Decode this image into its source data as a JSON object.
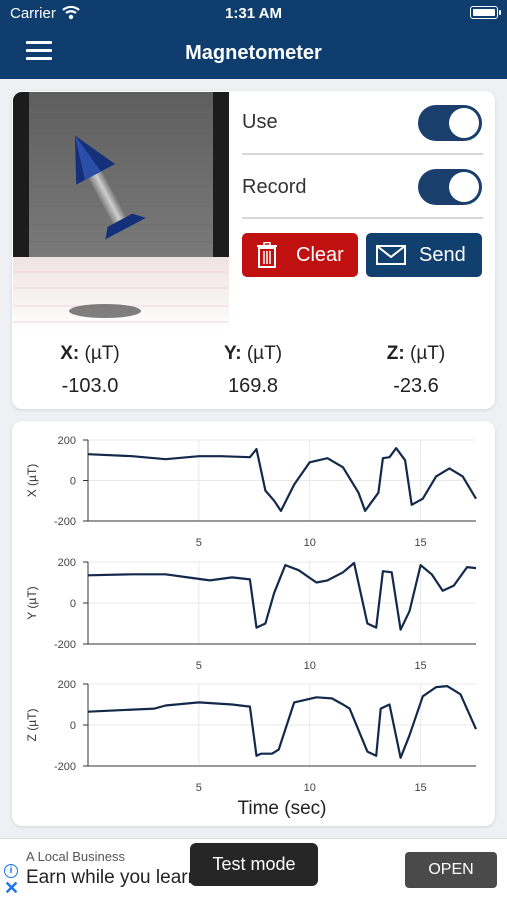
{
  "status_bar": {
    "carrier": "Carrier",
    "time": "1:31 AM"
  },
  "nav": {
    "title": "Magnetometer"
  },
  "controls": {
    "use_label": "Use",
    "use_on": true,
    "record_label": "Record",
    "record_on": true,
    "clear_label": "Clear",
    "send_label": "Send"
  },
  "readings": {
    "x_label": "X:",
    "x_unit": "(µT)",
    "x_value": "-103.0",
    "y_label": "Y:",
    "y_unit": "(µT)",
    "y_value": "169.8",
    "z_label": "Z:",
    "z_unit": "(µT)",
    "z_value": "-23.6"
  },
  "colors": {
    "bar": "#0e3d6e",
    "clear": "#c11010",
    "send": "#11406f",
    "line": "#13294b"
  },
  "chart_data": [
    {
      "type": "line",
      "ylabel": "X (µT)",
      "ylim": [
        -200,
        200
      ],
      "yticks": [
        200,
        0,
        -200
      ],
      "xlim": [
        0,
        17.5
      ],
      "xticks": [
        5,
        10,
        15
      ],
      "grid": true,
      "x": [
        0,
        2,
        3.5,
        5,
        6,
        7.3,
        7.6,
        8,
        8.4,
        8.7,
        9.3,
        10,
        10.8,
        11.5,
        12.2,
        12.5,
        13.1,
        13.3,
        13.6,
        13.9,
        14.3,
        14.6,
        15.1,
        15.7,
        16.3,
        16.9,
        17.5
      ],
      "y": [
        130,
        120,
        105,
        120,
        120,
        115,
        155,
        -50,
        -100,
        -150,
        -20,
        90,
        110,
        65,
        -60,
        -150,
        -60,
        110,
        115,
        160,
        100,
        -120,
        -90,
        20,
        60,
        20,
        -90
      ]
    },
    {
      "type": "line",
      "ylabel": "Y (µT)",
      "ylim": [
        -200,
        200
      ],
      "yticks": [
        200,
        0,
        -200
      ],
      "xlim": [
        0,
        17.5
      ],
      "xticks": [
        5,
        10,
        15
      ],
      "grid": true,
      "x": [
        0,
        2,
        3.5,
        4.5,
        5.5,
        6.5,
        7.3,
        7.6,
        8,
        8.4,
        8.9,
        9.5,
        10.3,
        10.8,
        11.5,
        12,
        12.6,
        13,
        13.3,
        13.7,
        14.1,
        14.5,
        15,
        15.5,
        16,
        16.5,
        17.1,
        17.5
      ],
      "y": [
        135,
        140,
        140,
        125,
        110,
        125,
        115,
        -120,
        -100,
        50,
        185,
        160,
        100,
        110,
        150,
        195,
        -100,
        -120,
        155,
        150,
        -130,
        -40,
        185,
        140,
        60,
        85,
        175,
        170
      ]
    },
    {
      "type": "line",
      "ylabel": "Z (µT)",
      "ylim": [
        -200,
        200
      ],
      "yticks": [
        200,
        0,
        -200
      ],
      "xlim": [
        0,
        17.5
      ],
      "xticks": [
        5,
        10,
        15
      ],
      "grid": true,
      "xlabel": "Time (sec)",
      "x": [
        0,
        2,
        3,
        3.5,
        5,
        6.5,
        7.3,
        7.6,
        7.8,
        8.3,
        8.6,
        9.3,
        10.3,
        11,
        11.5,
        11.8,
        12.6,
        13,
        13.2,
        13.6,
        14.1,
        14.5,
        15.1,
        15.7,
        16.2,
        16.8,
        17.5
      ],
      "y": [
        65,
        75,
        80,
        95,
        110,
        100,
        90,
        -150,
        -140,
        -140,
        -120,
        110,
        135,
        130,
        100,
        80,
        -130,
        -150,
        80,
        100,
        -160,
        -50,
        140,
        185,
        190,
        150,
        -20
      ]
    }
  ],
  "ad": {
    "advertiser": "A Local Business",
    "headline": "Earn while you learn",
    "badge": "Test mode",
    "cta": "OPEN"
  }
}
